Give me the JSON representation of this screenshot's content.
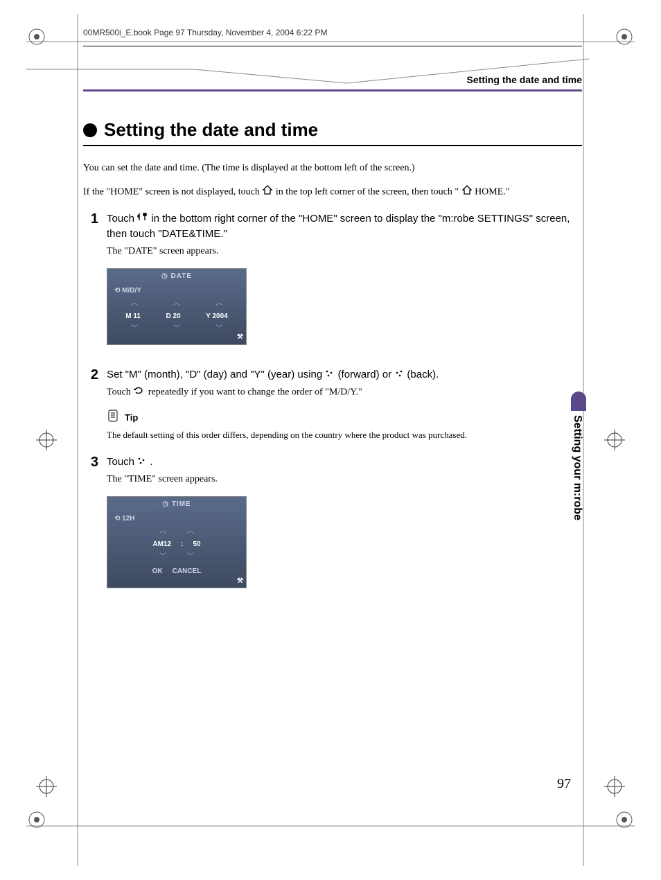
{
  "header_meta": "00MR500i_E.book  Page 97  Thursday, November 4, 2004  6:22 PM",
  "running_header": "Setting the date and time",
  "title": "Setting the date and time",
  "intro": "You can set the date and time. (The time is displayed at the bottom left of the screen.)",
  "precondition_a": "If the \"HOME\" screen is not displayed, touch ",
  "precondition_b": " in the top left corner of the screen, then touch \" ",
  "precondition_c": " HOME.\"",
  "step1": {
    "num": "1",
    "text_a": "Touch ",
    "text_b": " in the bottom right corner of the \"HOME\" screen to display the \"m:robe SETTINGS\" screen, then touch \"DATE&TIME.\"",
    "sub": "The \"DATE\" screen appears."
  },
  "date_screen": {
    "title": "DATE",
    "format_label": "M/D/Y",
    "month_label": "M",
    "month_val": "11",
    "day_label": "D",
    "day_val": "20",
    "year_label": "Y",
    "year_val": "2004"
  },
  "step2": {
    "num": "2",
    "text_a": "Set \"M\" (month), \"D\" (day) and \"Y\" (year) using ",
    "text_b": " (forward) or ",
    "text_c": " (back).",
    "sub_a": "Touch ",
    "sub_b": " repeatedly if you want to change the order of \"M/D/Y.\""
  },
  "tip": {
    "label": "Tip",
    "text": "The default setting of this order differs, depending on the country where the product was purchased."
  },
  "step3": {
    "num": "3",
    "text_a": "Touch ",
    "text_b": " .",
    "sub": "The \"TIME\" screen appears."
  },
  "time_screen": {
    "title": "TIME",
    "format_label": "12H",
    "hour": "AM12",
    "sep": ":",
    "min": "50",
    "ok": "OK",
    "cancel": "CANCEL"
  },
  "side_tab": "Setting your m:robe",
  "page_number": "97"
}
